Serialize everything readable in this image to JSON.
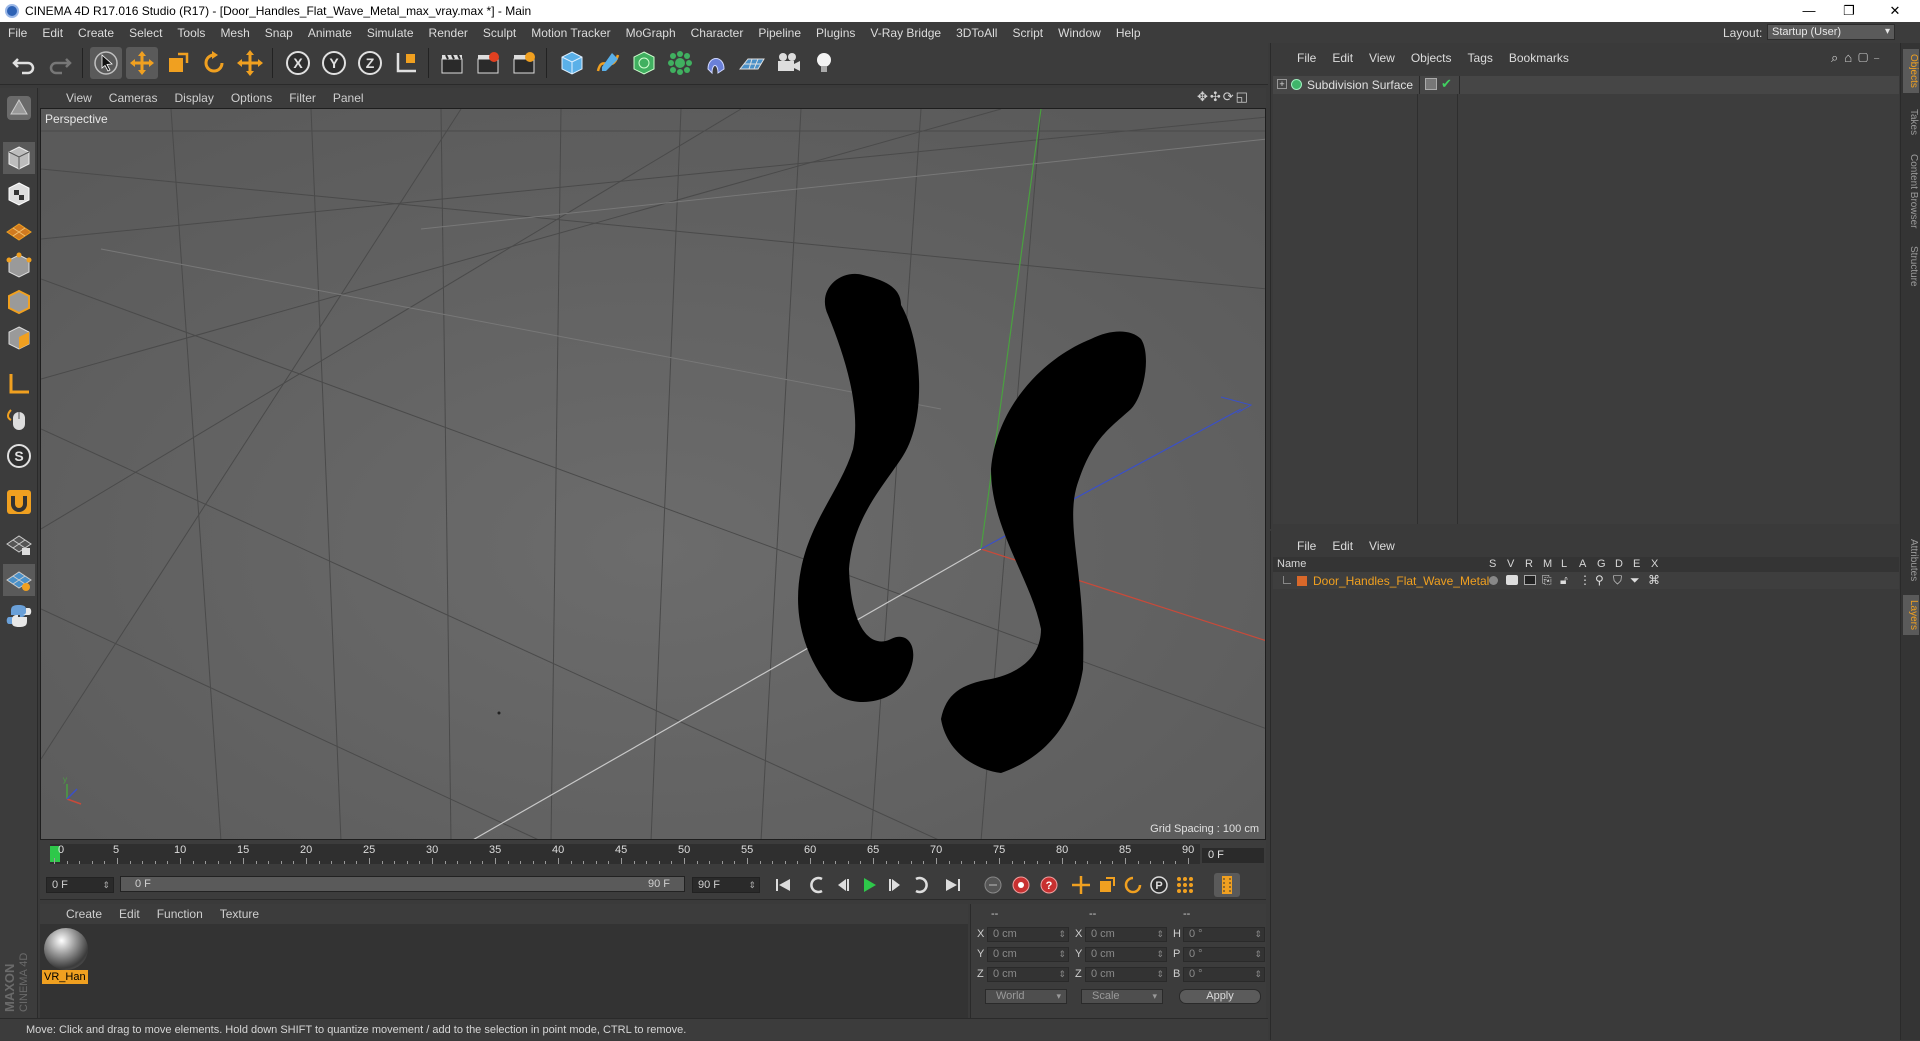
{
  "window": {
    "title": "CINEMA 4D R17.016 Studio (R17) - [Door_Handles_Flat_Wave_Metal_max_vray.max *] - Main"
  },
  "menu": [
    "File",
    "Edit",
    "Create",
    "Select",
    "Tools",
    "Mesh",
    "Snap",
    "Animate",
    "Simulate",
    "Render",
    "Sculpt",
    "Motion Tracker",
    "MoGraph",
    "Character",
    "Pipeline",
    "Plugins",
    "V-Ray Bridge",
    "3DToAll",
    "Script",
    "Window",
    "Help"
  ],
  "layout": {
    "label": "Layout:",
    "value": "Startup (User)"
  },
  "viewport": {
    "menu": [
      "View",
      "Cameras",
      "Display",
      "Options",
      "Filter",
      "Panel"
    ],
    "label": "Perspective",
    "grid_spacing": "Grid Spacing : 100 cm"
  },
  "timeline": {
    "ticks": [
      "0",
      "5",
      "10",
      "15",
      "20",
      "25",
      "30",
      "35",
      "40",
      "45",
      "50",
      "55",
      "60",
      "65",
      "70",
      "75",
      "80",
      "85",
      "90"
    ],
    "current_frame": "0 F",
    "start_field": "0 F",
    "slider_start": "0 F",
    "slider_end": "90 F",
    "end_field": "90 F"
  },
  "materials": {
    "menu": [
      "Create",
      "Edit",
      "Function",
      "Texture"
    ],
    "items": [
      {
        "name": "VR_Han"
      }
    ]
  },
  "coords": {
    "headers": [
      "--",
      "--",
      "--"
    ],
    "rows": [
      {
        "a": "X",
        "av": "0 cm",
        "b": "X",
        "bv": "0 cm",
        "c": "H",
        "cv": "0 °"
      },
      {
        "a": "Y",
        "av": "0 cm",
        "b": "Y",
        "bv": "0 cm",
        "c": "P",
        "cv": "0 °"
      },
      {
        "a": "Z",
        "av": "0 cm",
        "b": "Z",
        "bv": "0 cm",
        "c": "B",
        "cv": "0 °"
      }
    ],
    "world": "World",
    "scale": "Scale",
    "apply": "Apply"
  },
  "status": "Move: Click and drag to move elements. Hold down SHIFT to quantize movement / add to the selection in point mode, CTRL to remove.",
  "objects": {
    "menu": [
      "File",
      "Edit",
      "View",
      "Objects",
      "Tags",
      "Bookmarks"
    ],
    "items": [
      {
        "name": "Subdivision Surface"
      }
    ]
  },
  "layers": {
    "menu": [
      "File",
      "Edit",
      "View"
    ],
    "columns": {
      "name": "Name",
      "flags": [
        "S",
        "V",
        "R",
        "M",
        "L",
        "A",
        "G",
        "D",
        "E",
        "X"
      ]
    },
    "items": [
      {
        "name": "Door_Handles_Flat_Wave_Metal",
        "color": "#d9682a"
      }
    ]
  },
  "side_tabs": [
    "Objects",
    "Takes",
    "Content Browser",
    "Structure",
    "Attributes",
    "Layers"
  ],
  "brand": {
    "line1": "MAXON",
    "line2": "CINEMA 4D"
  },
  "colors": {
    "accent": "#f0a020",
    "layer_text": "#f0a020",
    "axis_x": "#c84a3a",
    "axis_y": "#4aa040",
    "axis_z": "#3a50c8"
  }
}
